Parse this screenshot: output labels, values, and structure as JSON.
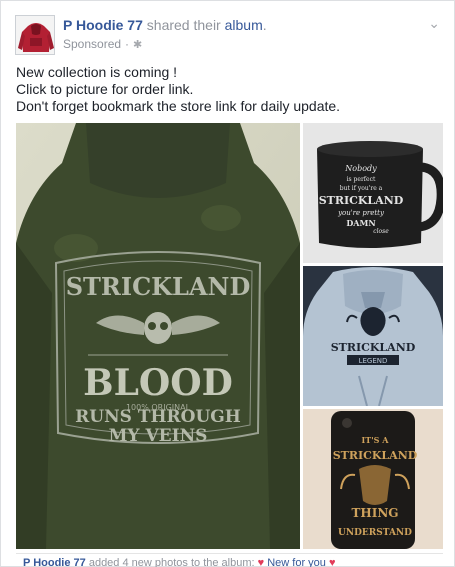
{
  "header": {
    "page_name": "P Hoodie 77",
    "action_text": "shared their",
    "album_link": "album",
    "period": ".",
    "sponsored": "Sponsored",
    "separator": "·",
    "gear_icon": "gear-icon",
    "chevron_icon": "chevron-down-icon"
  },
  "post": {
    "lines": [
      "New collection is coming !",
      "Click to picture for order link.",
      "Don't forget bookmark the store link for daily update."
    ]
  },
  "photos": {
    "main": {
      "title": "STRICKLAND",
      "word": "BLOOD",
      "small": "100% ORIGINAL",
      "line1": "RUNS THROUGH",
      "line2": "MY VEINS"
    },
    "mug": {
      "lines": [
        "Nobody",
        "is perfect",
        "but if you're a",
        "STRICKLAND",
        "you're pretty",
        "DAMN",
        "close"
      ]
    },
    "hoodie": {
      "name": "STRICKLAND",
      "tag": "LEGEND"
    },
    "phone": {
      "top": "IT'S A",
      "name": "STRICKLAND",
      "mid": "THING",
      "bottom": "UNDERSTAND"
    }
  },
  "footer": {
    "page_name": "P Hoodie 77",
    "text": "added 4 new photos to the album:",
    "album_name": "New for you",
    "heart_glyph": "♥"
  }
}
